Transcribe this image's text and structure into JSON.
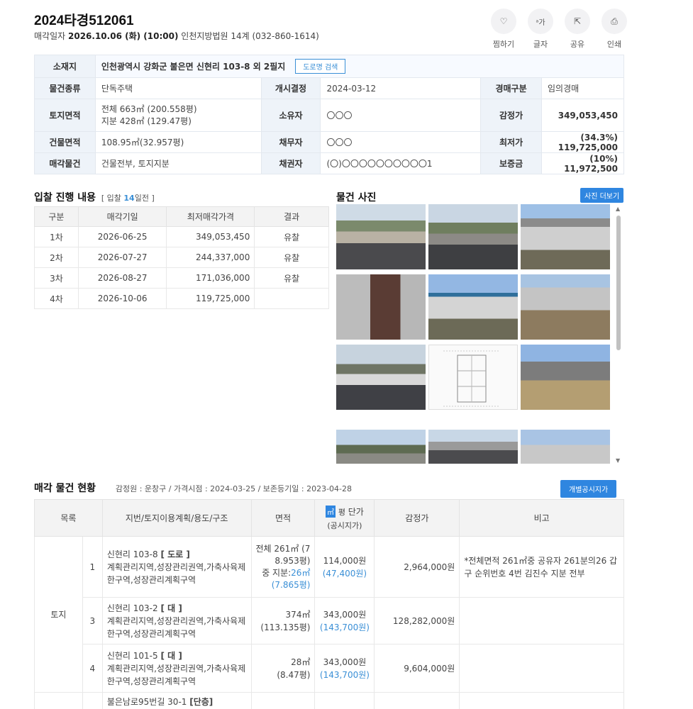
{
  "header": {
    "case_no": "2024타경512061",
    "sale_date_label": "매각일자",
    "sale_date": "2026.10.06 (화) (10:00)",
    "court": "인천지방법원 14계 (032-860-1614)"
  },
  "actions": [
    {
      "label": "찜하기",
      "icon": "heart-icon",
      "glyph": "♡"
    },
    {
      "label": "글자",
      "icon": "font-size-icon",
      "glyph": "ᵃ가"
    },
    {
      "label": "공유",
      "icon": "share-icon",
      "glyph": "⇱"
    },
    {
      "label": "인쇄",
      "icon": "print-icon",
      "glyph": "⎙"
    }
  ],
  "info": {
    "location_label": "소재지",
    "location": "인천광역시 강화군 불은면 신현리 103-8 외 2필지",
    "road_search": "도로명 검색",
    "type_label": "물건종류",
    "type": "단독주택",
    "open_label": "개시결정",
    "open_date": "2024-03-12",
    "auction_kind_label": "경매구분",
    "auction_kind": "임의경매",
    "land_label": "토지면적",
    "land_line1": "전체 663㎡ (200.558평)",
    "land_line2": "지분 428㎡ (129.47평)",
    "owner_label": "소유자",
    "owner": "〇〇〇",
    "appraisal_label": "감정가",
    "appraisal": "349,053,450",
    "building_label": "건물면적",
    "building": "108.95㎡(32.957평)",
    "debtor_label": "채무자",
    "debtor": "〇〇〇",
    "min_label": "최저가",
    "min_price": "(34.3%) 119,725,000",
    "object_label": "매각물건",
    "object": "건물전부, 토지지분",
    "creditor_label": "채권자",
    "creditor": "(〇)〇〇〇〇〇〇〇〇〇〇1",
    "deposit_label": "보증금",
    "deposit": "(10%) 11,972,500"
  },
  "bids": {
    "title": "입찰 진행 내용",
    "meta_prefix": "[ 입찰 ",
    "meta_count": "14",
    "meta_suffix": "일전 ]",
    "headers": [
      "구분",
      "매각기일",
      "최저매각가격",
      "결과"
    ],
    "rows": [
      {
        "round": "1차",
        "date": "2026-06-25",
        "price": "349,053,450",
        "result": "유찰"
      },
      {
        "round": "2차",
        "date": "2026-07-27",
        "price": "244,337,000",
        "result": "유찰"
      },
      {
        "round": "3차",
        "date": "2026-08-27",
        "price": "171,036,000",
        "result": "유찰"
      },
      {
        "round": "4차",
        "date": "2026-10-06",
        "price": "119,725,000",
        "result": ""
      }
    ]
  },
  "photos": {
    "title": "물건 사진",
    "more_button": "사진 더보기"
  },
  "status": {
    "title": "매각 물건 현황",
    "meta": "감정원 : 운창구 / 가격시점 : 2024-03-25 / 보존등기일 : 2023-04-28",
    "button": "개별공시지가",
    "headers": {
      "list": "목록",
      "desc": "지번/토지이용계획/용도/구조",
      "area": "면적",
      "unit_m2": "㎡",
      "unit_py": "평",
      "unit_price": "단가",
      "unit_sub": "(공시지가)",
      "appraisal": "감정가",
      "note": "비고"
    },
    "group_label": "토지",
    "rows": [
      {
        "no": "1",
        "addr": "신현리 103-8",
        "kind": "[ 도로 ]",
        "zoning": "계획관리지역,성장관리권역,가축사육제한구역,성장관리계획구역",
        "area_l1": "전체 261㎡ (7",
        "area_l2": "8.953평)",
        "area_l3": "중 지분:",
        "area_l3b": "26㎡",
        "area_l4": "(7.865평)",
        "price": "114,000원",
        "gov_price": "(47,400원)",
        "appraisal": "2,964,000원",
        "note": "*전체면적 261㎡중 공유자 261분의26 갑구 순위번호 4번 김진수 지분 전부"
      },
      {
        "no": "3",
        "addr": "신현리 103-2",
        "kind": "[ 대 ]",
        "zoning": "계획관리지역,성장관리권역,가축사육제한구역,성장관리계획구역",
        "area_l1": "374㎡",
        "area_l2": "(113.135평)",
        "price": "343,000원",
        "gov_price": "(143,700원)",
        "appraisal": "128,282,000원",
        "note": ""
      },
      {
        "no": "4",
        "addr": "신현리 101-5",
        "kind": "[ 대 ]",
        "zoning": "계획관리지역,성장관리권역,가축사육제한구역,성장관리계획구역",
        "area_l1": "28㎡",
        "area_l2": "(8.47평)",
        "price": "343,000원",
        "gov_price": "(143,700원)",
        "appraisal": "9,604,000원",
        "note": ""
      }
    ],
    "partial_row": {
      "addr": "불은남로95번길 30-1",
      "kind": "[단층]"
    }
  }
}
